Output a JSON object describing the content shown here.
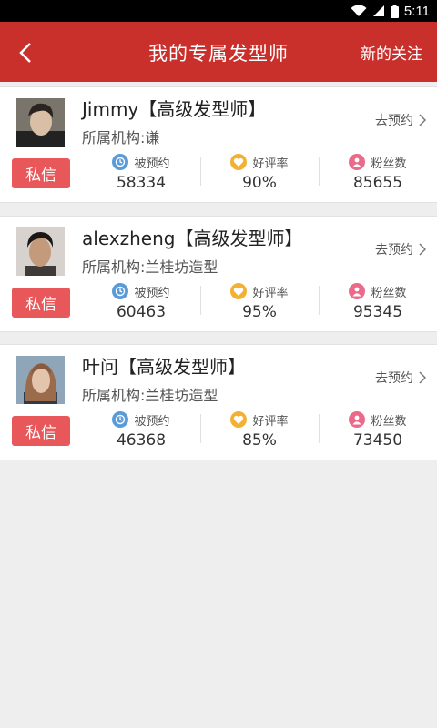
{
  "status_bar": {
    "time": "5:11"
  },
  "header": {
    "title": "我的专属发型师",
    "action_label": "新的关注"
  },
  "colors": {
    "header_bg": "#c9302c",
    "message_button": "#e8575a",
    "booked_icon": "#5b9bd8",
    "rating_icon": "#f2b134",
    "fans_icon": "#ea6a8a"
  },
  "stylists": [
    {
      "name": "Jimmy【高级发型师】",
      "org": "所属机构:谦",
      "book_label": "去预约",
      "message_label": "私信",
      "stats": [
        {
          "label": "被预约",
          "value": "58334",
          "icon": "clock-icon"
        },
        {
          "label": "好评率",
          "value": "90%",
          "icon": "heart-icon"
        },
        {
          "label": "粉丝数",
          "value": "85655",
          "icon": "person-icon"
        }
      ]
    },
    {
      "name": "alexzheng【高级发型师】",
      "org": "所属机构:兰桂坊造型",
      "book_label": "去预约",
      "message_label": "私信",
      "stats": [
        {
          "label": "被预约",
          "value": "60463",
          "icon": "clock-icon"
        },
        {
          "label": "好评率",
          "value": "95%",
          "icon": "heart-icon"
        },
        {
          "label": "粉丝数",
          "value": "95345",
          "icon": "person-icon"
        }
      ]
    },
    {
      "name": "叶问【高级发型师】",
      "org": "所属机构:兰桂坊造型",
      "book_label": "去预约",
      "message_label": "私信",
      "stats": [
        {
          "label": "被预约",
          "value": "46368",
          "icon": "clock-icon"
        },
        {
          "label": "好评率",
          "value": "85%",
          "icon": "heart-icon"
        },
        {
          "label": "粉丝数",
          "value": "73450",
          "icon": "person-icon"
        }
      ]
    }
  ]
}
